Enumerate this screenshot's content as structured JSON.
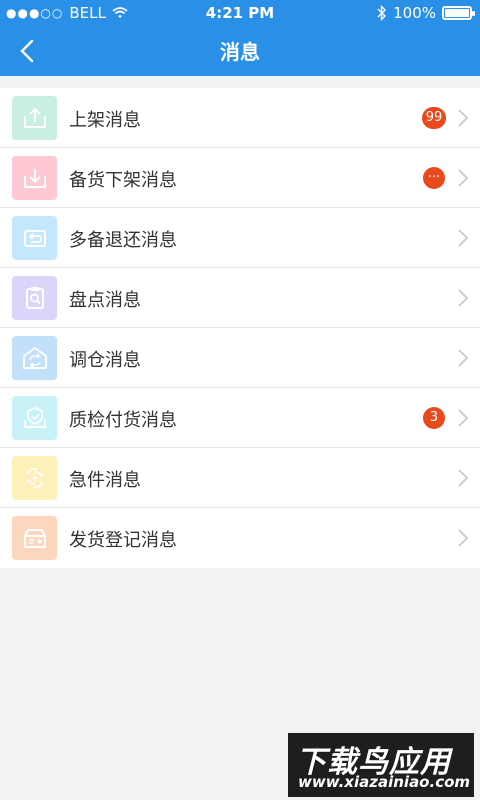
{
  "status_bar": {
    "carrier": "BELL",
    "time": "4:21 PM",
    "battery": "100%",
    "battery_level": 1.0
  },
  "nav": {
    "title": "消息"
  },
  "colors": {
    "header": "#2a8fe6",
    "badge": "#e84a1e",
    "icon_backgrounds": [
      "#c8efe0",
      "#ffc9d3",
      "#c4e8fb",
      "#dcd5fb",
      "#c2e0fa",
      "#c8f2f7",
      "#fdf0b8",
      "#fdd7bd"
    ]
  },
  "messages": [
    {
      "label": "上架消息",
      "icon": "shelf-up-icon",
      "badge": "99"
    },
    {
      "label": "备货下架消息",
      "icon": "shelf-down-icon",
      "badge": "···"
    },
    {
      "label": "多备退还消息",
      "icon": "return-icon",
      "badge": ""
    },
    {
      "label": "盘点消息",
      "icon": "inventory-check-icon",
      "badge": ""
    },
    {
      "label": "调仓消息",
      "icon": "warehouse-transfer-icon",
      "badge": ""
    },
    {
      "label": "质检付货消息",
      "icon": "quality-check-icon",
      "badge": "3"
    },
    {
      "label": "急件消息",
      "icon": "urgent-icon",
      "badge": ""
    },
    {
      "label": "发货登记消息",
      "icon": "shipping-register-icon",
      "badge": ""
    }
  ],
  "watermark": {
    "title": "下载鸟应用",
    "url": "www.xiazainiao.com"
  }
}
